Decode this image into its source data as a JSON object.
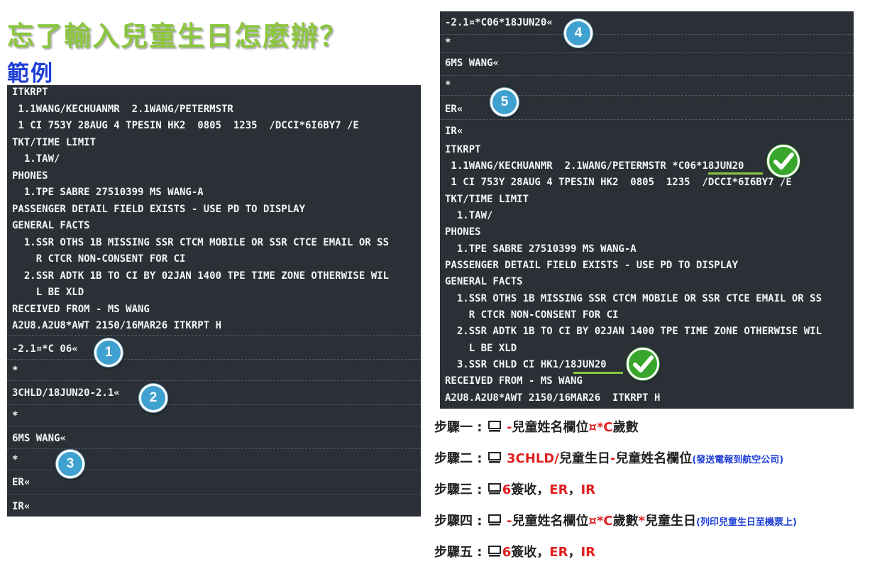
{
  "page": {
    "title": "忘了輸入兒童生日怎麼辦？",
    "subtitle": "範例"
  },
  "left_terminal": {
    "lines": [
      "ITKRPT",
      " 1.1WANG/KECHUANMR  2.1WANG/PETERMSTR",
      " 1 CI 753Y 28AUG 4 TPESIN HK2  0805  1235  /DCCI*6I6BY7 /E",
      "TKT/TIME LIMIT",
      "  1.TAW/",
      "PHONES",
      "  1.TPE SABRE 27510399 MS WANG-A",
      "PASSENGER DETAIL FIELD EXISTS - USE PD TO DISPLAY",
      "GENERAL FACTS",
      "  1.SSR OTHS 1B MISSING SSR CTCM MOBILE OR SSR CTCE EMAIL OR SS",
      "    R CTCR NON-CONSENT FOR CI",
      "  2.SSR ADTK 1B TO CI BY 02JAN 1400 TPE TIME ZONE OTHERWISE WIL",
      "    L BE XLD",
      "RECEIVED FROM - MS WANG",
      "A2U8.A2U8*AWT 2150/16MAR26 ITKRPT H"
    ],
    "commands": [
      "-2.1¤*C 06«",
      "*",
      "3CHLD/18JUN20-2.1«",
      "*",
      "6MS WANG«",
      "*",
      "ER«",
      "IR«"
    ]
  },
  "right_terminal": {
    "commands": [
      "-2.1¤*C06*18JUN20«",
      "*",
      "6MS WANG«",
      "*",
      "ER«"
    ],
    "lines": [
      "IR«",
      "ITKRPT",
      " 1.1WANG/KECHUANMR  2.1WANG/PETERMSTR *C06*18JUN20",
      " 1 CI 753Y 28AUG 4 TPESIN HK2  0805  1235  /DCCI*6I6BY7 /E",
      "TKT/TIME LIMIT",
      "  1.TAW/",
      "PHONES",
      "  1.TPE SABRE 27510399 MS WANG-A",
      "PASSENGER DETAIL FIELD EXISTS - USE PD TO DISPLAY",
      "GENERAL FACTS",
      "  1.SSR OTHS 1B MISSING SSR CTCM MOBILE OR SSR CTCE EMAIL OR SS",
      "    R CTCR NON-CONSENT FOR CI",
      "  2.SSR ADTK 1B TO CI BY 02JAN 1400 TPE TIME ZONE OTHERWISE WIL",
      "    L BE XLD",
      "  3.SSR CHLD CI HK1/18JUN20",
      "RECEIVED FROM - MS WANG",
      "A2U8.A2U8*AWT 2150/16MAR26  ITKRPT H"
    ]
  },
  "badges": [
    "1",
    "2",
    "3",
    "4",
    "5"
  ],
  "icons": {
    "step_icon": "computer-icon",
    "confirm_icon": "check-icon"
  },
  "colors": {
    "title_green": "#8cc63f",
    "subtitle_blue": "#1f3fd6",
    "terminal_bg": "#2b3036",
    "badge_blue": "#3fa1cf",
    "check_green": "#37a62b",
    "accent_red": "#e02020"
  },
  "steps": [
    {
      "label": "步驟一 :",
      "dash": "-",
      "text1": "兒童姓名欄位",
      "red1": "¤*C",
      "text2": "歲數"
    },
    {
      "label": "步驟二 :",
      "red1": "3CHLD/",
      "text1": "兒童生日",
      "dash": "-",
      "text2": "兒童姓名欄位",
      "note": "(發送電報到航空公司)"
    },
    {
      "label": "步驟三 :",
      "red1": "6",
      "text1": "簽收，",
      "red2": "ER",
      "text2": "，",
      "red3": "IR"
    },
    {
      "label": "步驟四 :",
      "dash": "-",
      "text1": "兒童姓名欄位",
      "red1": "¤*C",
      "text2": "歲數",
      "red2": "*",
      "text3": "兒童生日",
      "note": "(列印兒童生日至機票上)"
    },
    {
      "label": "步驟五 :",
      "red1": "6",
      "text1": "簽收，",
      "red2": "ER",
      "text2": "，",
      "red3": "IR"
    }
  ]
}
